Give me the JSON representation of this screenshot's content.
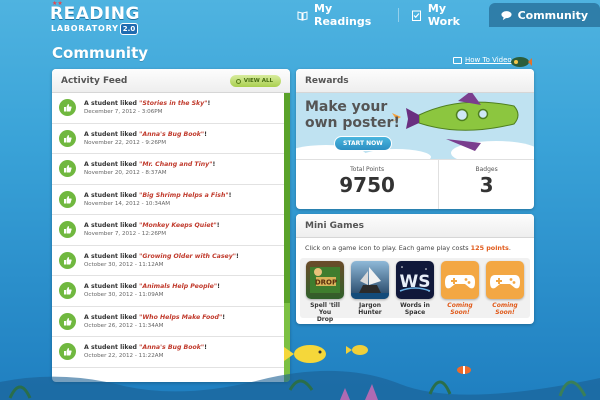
{
  "logo": {
    "line1": "READING",
    "line2": "LABORATORY",
    "version": "2.0"
  },
  "nav": {
    "tabs": [
      {
        "label": "My Readings",
        "icon": "book-icon",
        "active": false
      },
      {
        "label": "My Work",
        "icon": "checklist-icon",
        "active": false
      },
      {
        "label": "Community",
        "icon": "speech-bubble-icon",
        "active": true
      }
    ]
  },
  "page": {
    "title": "Community",
    "howto_link": "How To Video"
  },
  "feed": {
    "title": "Activity Feed",
    "view_all": "VIEW ALL",
    "items": [
      {
        "prefix": "A student liked ",
        "book": "\"Stories in the Sky\"",
        "suffix": "!",
        "date": "December 7, 2012 - 3:06PM"
      },
      {
        "prefix": "A student liked ",
        "book": "\"Anna's Bug Book\"",
        "suffix": "!",
        "date": "November 22, 2012 - 9:26PM"
      },
      {
        "prefix": "A student liked ",
        "book": "\"Mr. Chang and Tiny\"",
        "suffix": "!",
        "date": "November 20, 2012 - 8:37AM"
      },
      {
        "prefix": "A student liked ",
        "book": "\"Big Shrimp Helps a Fish\"",
        "suffix": "!",
        "date": "November 14, 2012 - 10:34AM"
      },
      {
        "prefix": "A student liked ",
        "book": "\"Monkey Keeps Quiet\"",
        "suffix": "!",
        "date": "November 7, 2012 - 12:26PM"
      },
      {
        "prefix": "A student liked ",
        "book": "\"Growing Older with Casey\"",
        "suffix": "!",
        "date": "October 30, 2012 - 11:12AM"
      },
      {
        "prefix": "A student liked ",
        "book": "\"Animals Help People\"",
        "suffix": "!",
        "date": "October 30, 2012 - 11:09AM"
      },
      {
        "prefix": "A student liked ",
        "book": "\"Who Helps Make Food\"",
        "suffix": "!",
        "date": "October 26, 2012 - 11:34AM"
      },
      {
        "prefix": "A student liked ",
        "book": "\"Anna's Bug Book\"",
        "suffix": "!",
        "date": "October 22, 2012 - 11:22AM"
      }
    ]
  },
  "rewards": {
    "title": "Rewards",
    "poster_line1": "Make your",
    "poster_line2": "own poster!",
    "start_button": "START NOW",
    "points_label": "Total Points",
    "points_value": "9750",
    "badges_label": "Badges",
    "badges_value": "3"
  },
  "games": {
    "title": "Mini Games",
    "desc_prefix": "Click on a game icon to play. Each game play costs ",
    "desc_cost": "125 points",
    "desc_suffix": ".",
    "items": [
      {
        "label_1": "Spell 'till You",
        "label_2": "Drop",
        "soon": false
      },
      {
        "label_1": "Jargon",
        "label_2": "Hunter",
        "soon": false
      },
      {
        "label_1": "Words in",
        "label_2": "Space",
        "soon": false
      },
      {
        "label_1": "Coming Soon!",
        "label_2": "",
        "soon": true
      },
      {
        "label_1": "Coming Soon!",
        "label_2": "",
        "soon": true
      }
    ]
  },
  "colors": {
    "accent_green": "#7cc043",
    "accent_orange": "#e05a1a",
    "ocean_blue": "#3aa3d8",
    "tab_active": "#2f7ea9"
  }
}
